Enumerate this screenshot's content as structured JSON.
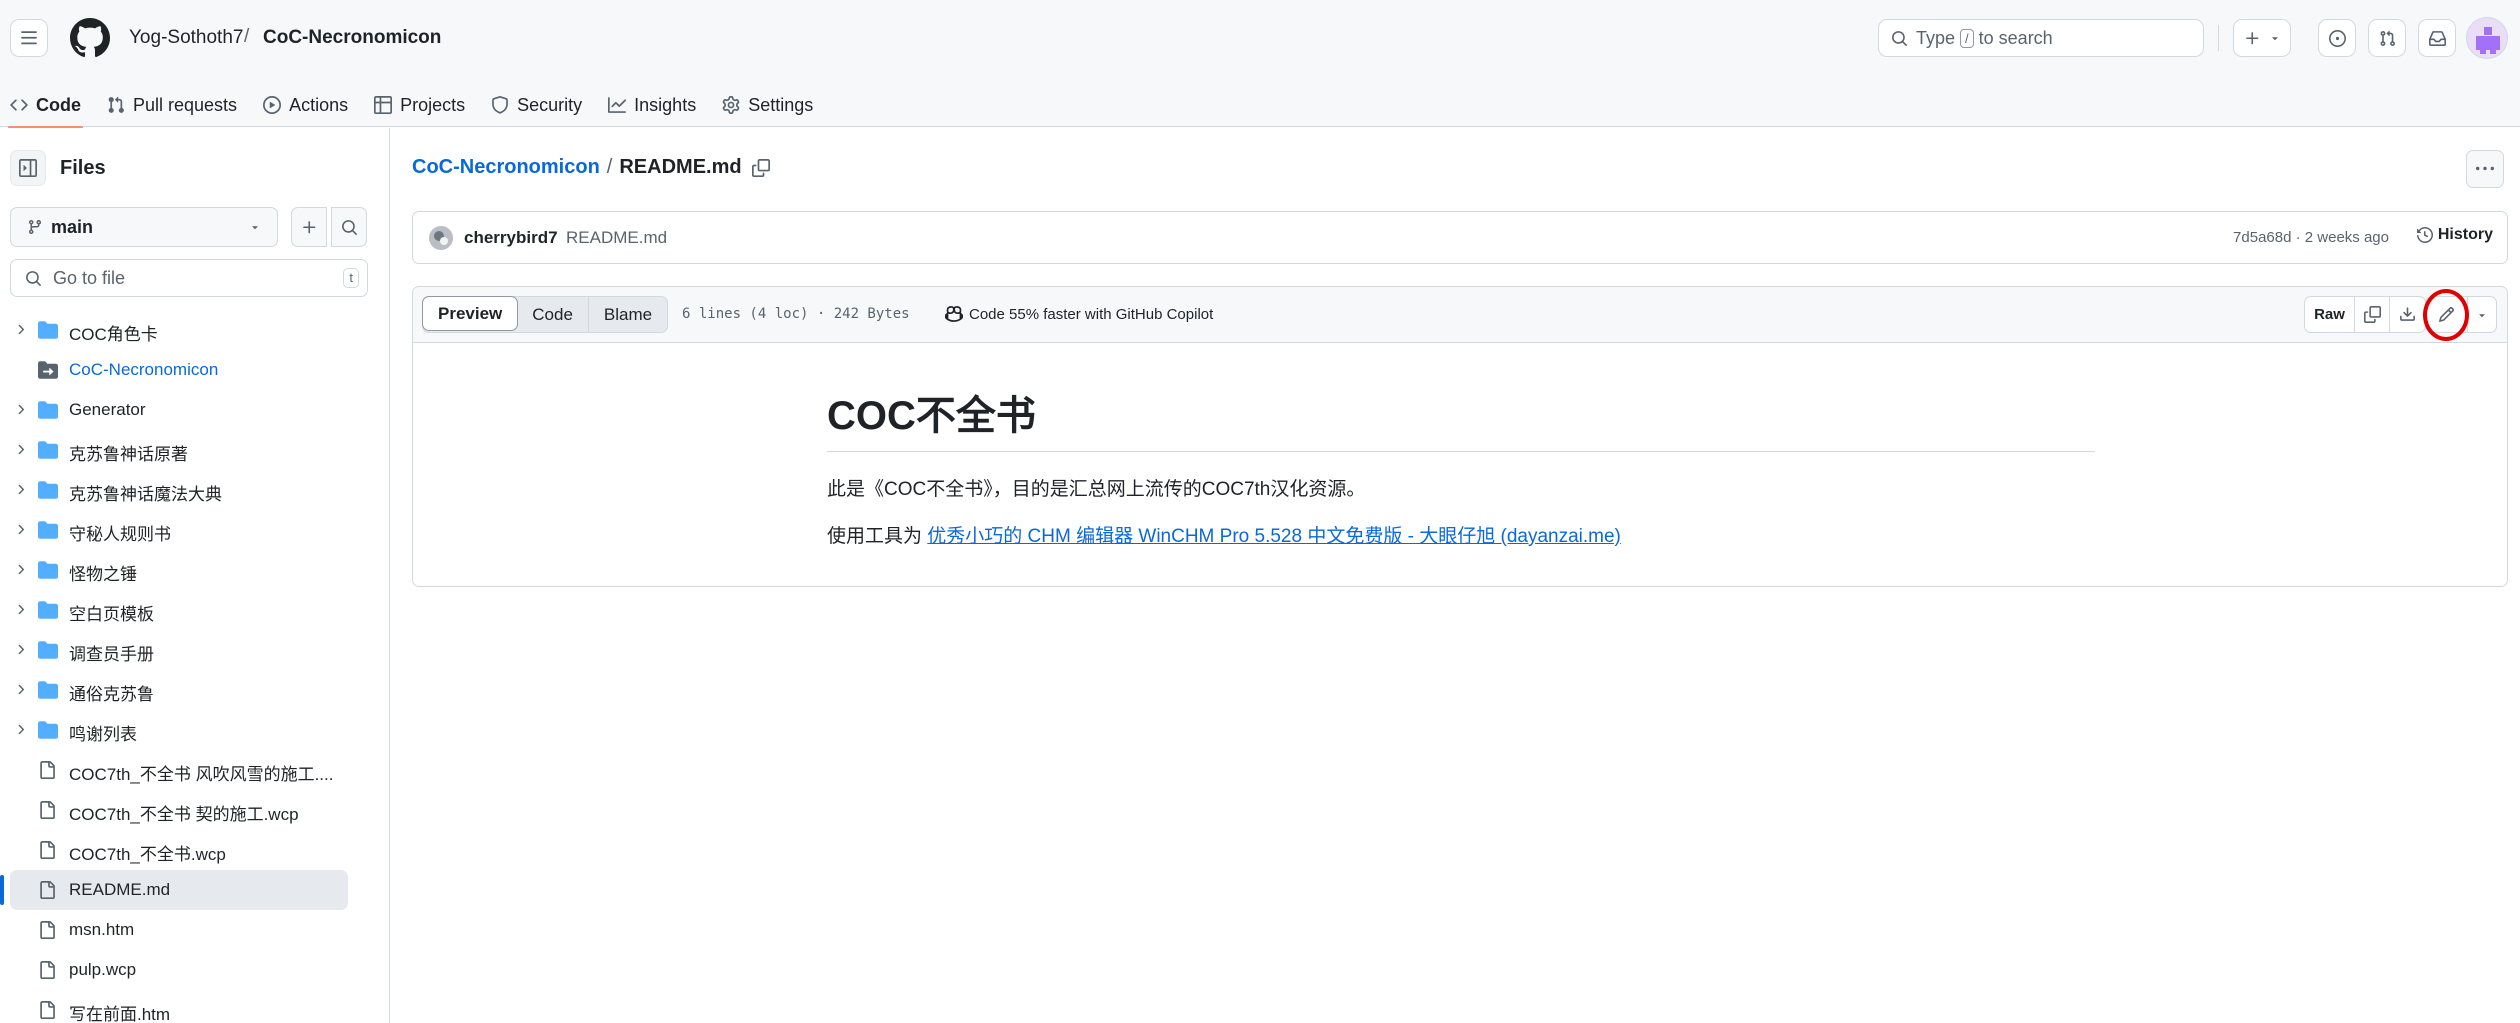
{
  "header": {
    "owner": "Yog-Sothoth7",
    "separator": "/",
    "repo": "CoC-Necronomicon",
    "search": {
      "prefix": "Type",
      "key": "/",
      "suffix": "to search"
    }
  },
  "repo_nav": [
    {
      "label": "Code",
      "icon": "code-icon",
      "active": true
    },
    {
      "label": "Pull requests",
      "icon": "pull-request-icon"
    },
    {
      "label": "Actions",
      "icon": "play-icon"
    },
    {
      "label": "Projects",
      "icon": "table-icon"
    },
    {
      "label": "Security",
      "icon": "shield-icon"
    },
    {
      "label": "Insights",
      "icon": "graph-icon"
    },
    {
      "label": "Settings",
      "icon": "gear-icon"
    }
  ],
  "sidebar": {
    "title": "Files",
    "branch": "main",
    "goto_placeholder": "Go to file",
    "goto_key": "t",
    "items": [
      {
        "label": "COC角色卡",
        "type": "folder"
      },
      {
        "label": "CoC-Necronomicon",
        "type": "submodule"
      },
      {
        "label": "Generator",
        "type": "folder"
      },
      {
        "label": "克苏鲁神话原著",
        "type": "folder"
      },
      {
        "label": "克苏鲁神话魔法大典",
        "type": "folder"
      },
      {
        "label": "守秘人规则书",
        "type": "folder"
      },
      {
        "label": "怪物之锤",
        "type": "folder"
      },
      {
        "label": "空白页模板",
        "type": "folder"
      },
      {
        "label": "调查员手册",
        "type": "folder"
      },
      {
        "label": "通俗克苏鲁",
        "type": "folder"
      },
      {
        "label": "鸣谢列表",
        "type": "folder"
      },
      {
        "label": "COC7th_不全书 风吹风雪的施工....",
        "type": "file"
      },
      {
        "label": "COC7th_不全书 契的施工.wcp",
        "type": "file"
      },
      {
        "label": "COC7th_不全书.wcp",
        "type": "file"
      },
      {
        "label": "README.md",
        "type": "file",
        "selected": true
      },
      {
        "label": "msn.htm",
        "type": "file"
      },
      {
        "label": "pulp.wcp",
        "type": "file"
      },
      {
        "label": "写在前面.htm",
        "type": "file"
      }
    ]
  },
  "main": {
    "path_repo": "CoC-Necronomicon",
    "path_sep": "/",
    "path_file": "README.md",
    "commit": {
      "author": "cherrybird7",
      "message": "README.md",
      "meta": "7d5a68d · 2 weeks ago",
      "history_label": "History"
    },
    "toolbar": {
      "tabs": [
        "Preview",
        "Code",
        "Blame"
      ],
      "file_info": "6 lines (4 loc) · 242 Bytes",
      "copilot": "Code 55% faster with GitHub Copilot",
      "raw_label": "Raw"
    },
    "readme": {
      "heading": "COC不全书",
      "para1": "此是《COC不全书》，目的是汇总网上流传的COC7th汉化资源。",
      "para2_prefix": "使用工具为 ",
      "para2_link": "优秀小巧的 CHM 编辑器 WinCHM Pro 5.528 中文免费版 - 大眼仔旭 (dayanzai.me)"
    }
  },
  "colors": {
    "link": "#0969da",
    "active_tab_underline": "#fd8c73",
    "folder": "#54aeff",
    "highlight_ring": "#e00000"
  }
}
